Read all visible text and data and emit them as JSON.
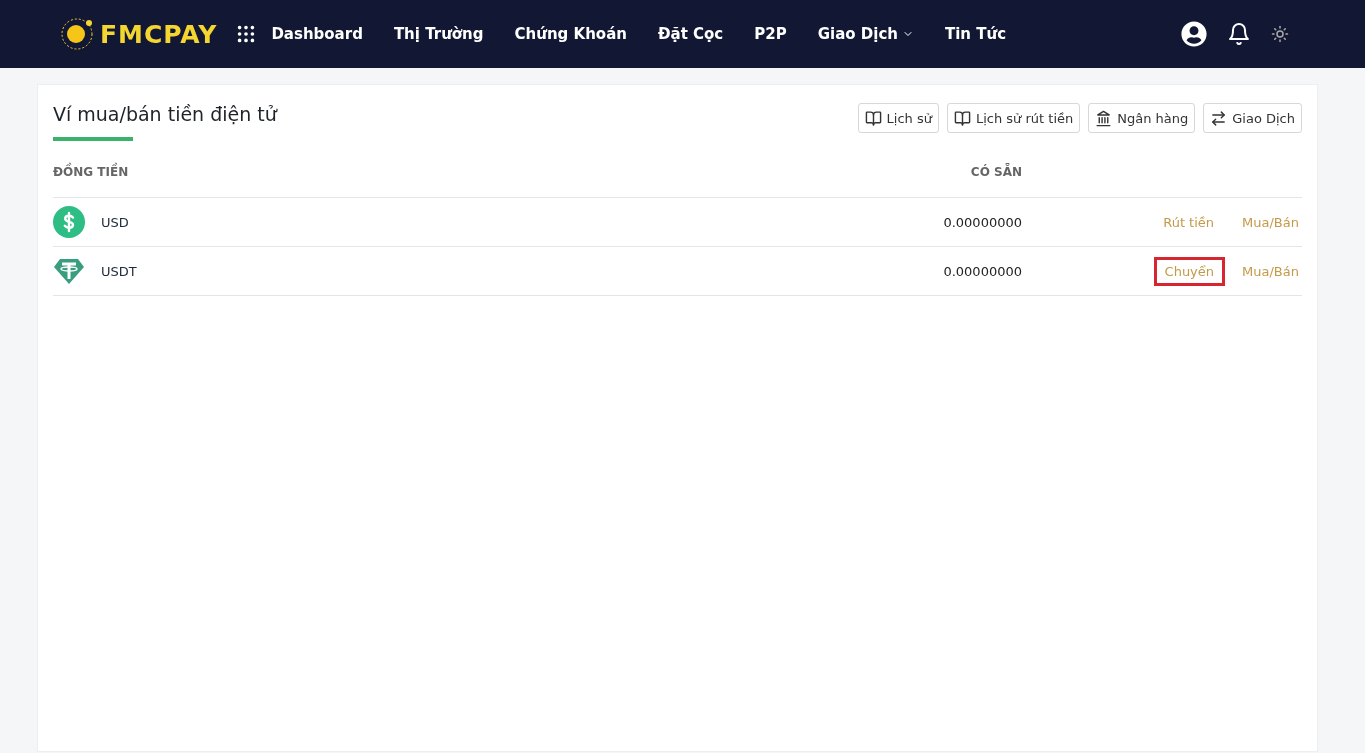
{
  "logo": {
    "text": "FMCPAY"
  },
  "nav": [
    {
      "label": "Dashboard",
      "dropdown": false
    },
    {
      "label": "Thị Trường",
      "dropdown": false
    },
    {
      "label": "Chứng Khoán",
      "dropdown": false
    },
    {
      "label": "Đặt Cọc",
      "dropdown": false
    },
    {
      "label": "P2P",
      "dropdown": false
    },
    {
      "label": "Giao Dịch",
      "dropdown": true
    },
    {
      "label": "Tin Tức",
      "dropdown": false
    }
  ],
  "wallet": {
    "title": "Ví mua/bán tiền điện tử",
    "buttons": [
      {
        "label": "Lịch sử",
        "kind": "book"
      },
      {
        "label": "Lịch sử rút tiền",
        "kind": "book"
      },
      {
        "label": "Ngân hàng",
        "kind": "bank"
      },
      {
        "label": "Giao Dịch",
        "kind": "swap"
      }
    ],
    "columns": [
      "ĐỒNG TIỀN",
      "CÓ SẴN"
    ],
    "rows": [
      {
        "coin": "USD",
        "kind": "dollar",
        "available": "0.00000000",
        "actions": [
          {
            "label": "Rút tiền",
            "highlighted": false
          },
          {
            "label": "Mua/Bán",
            "highlighted": false
          }
        ]
      },
      {
        "coin": "USDT",
        "kind": "tether",
        "available": "0.00000000",
        "actions": [
          {
            "label": "Chuyển",
            "highlighted": true
          },
          {
            "label": "Mua/Bán",
            "highlighted": false
          }
        ]
      }
    ]
  }
}
